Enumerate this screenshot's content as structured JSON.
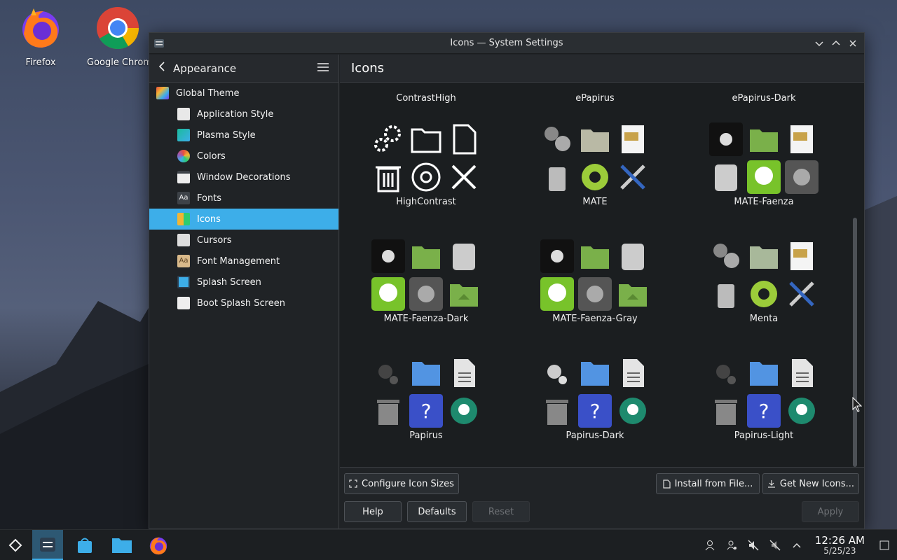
{
  "desktop": {
    "icons": [
      {
        "label": "Firefox"
      },
      {
        "label": "Google Chrome"
      }
    ]
  },
  "window": {
    "title": "Icons — System Settings"
  },
  "sidebar": {
    "breadcrumb": "Appearance",
    "items": [
      {
        "label": "Global Theme",
        "level": "top"
      },
      {
        "label": "Application Style",
        "level": "sub"
      },
      {
        "label": "Plasma Style",
        "level": "sub"
      },
      {
        "label": "Colors",
        "level": "sub"
      },
      {
        "label": "Window Decorations",
        "level": "sub"
      },
      {
        "label": "Fonts",
        "level": "sub"
      },
      {
        "label": "Icons",
        "level": "sub",
        "active": true
      },
      {
        "label": "Cursors",
        "level": "sub"
      },
      {
        "label": "Font Management",
        "level": "sub"
      },
      {
        "label": "Splash Screen",
        "level": "sub"
      },
      {
        "label": "Boot Splash Screen",
        "level": "sub"
      }
    ]
  },
  "main": {
    "title": "Icons",
    "themes_top": [
      "ContrastHigh",
      "ePapirus",
      "ePapirus-Dark"
    ],
    "themes": [
      {
        "name": "HighContrast",
        "style": "contrast"
      },
      {
        "name": "MATE",
        "style": "mate"
      },
      {
        "name": "MATE-Faenza",
        "style": "faenza"
      },
      {
        "name": "MATE-Faenza-Dark",
        "style": "faenza"
      },
      {
        "name": "MATE-Faenza-Gray",
        "style": "faenza"
      },
      {
        "name": "Menta",
        "style": "mate"
      },
      {
        "name": "Papirus",
        "style": "papirus"
      },
      {
        "name": "Papirus-Dark",
        "style": "papirus"
      },
      {
        "name": "Papirus-Light",
        "style": "papirus"
      }
    ]
  },
  "footer": {
    "configure_sizes": "Configure Icon Sizes",
    "install_from_file": "Install from File...",
    "get_new": "Get New Icons...",
    "help": "Help",
    "defaults": "Defaults",
    "reset": "Reset",
    "apply": "Apply"
  },
  "taskbar": {
    "time": "12:26 AM",
    "date": "5/25/23"
  },
  "colors": {
    "accent": "#3daee9",
    "window_bg": "#202326",
    "content_bg": "#1b1e20"
  }
}
